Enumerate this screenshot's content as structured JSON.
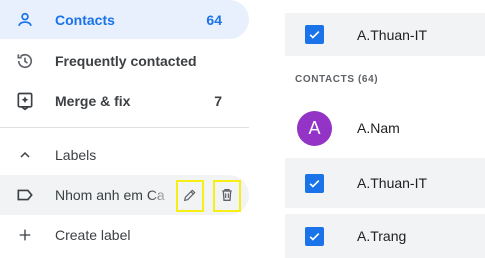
{
  "sidebar": {
    "contacts": {
      "label": "Contacts",
      "count": "64",
      "icon": "person-icon"
    },
    "frequent": {
      "label": "Frequently contacted",
      "icon": "history-icon"
    },
    "merge": {
      "label": "Merge & fix",
      "count": "7",
      "icon": "merge-fix-icon"
    },
    "labels_header": {
      "label": "Labels",
      "icon": "chevron-up-icon"
    },
    "label_item": {
      "label": "Nhom anh em Ca",
      "icon": "label-icon"
    },
    "create_label": {
      "label": "Create label",
      "icon": "plus-icon"
    }
  },
  "label_actions": {
    "edit_icon": "pencil-icon",
    "delete_icon": "trash-icon",
    "highlight_color": "#f5ef16"
  },
  "contacts_list": {
    "section_header": "CONTACTS (64)",
    "rows": [
      {
        "name": "A.Thuan-IT",
        "selected": true
      },
      {
        "name": "A.Nam",
        "avatar_letter": "A",
        "avatar_color": "#9334c6"
      },
      {
        "name": "A.Thuan-IT",
        "selected": true
      },
      {
        "name": "A.Trang",
        "selected": true
      }
    ]
  },
  "colors": {
    "accent": "#1a73e8",
    "active_bg": "#e8f0fe",
    "hover_bg": "#f1f3f4"
  }
}
